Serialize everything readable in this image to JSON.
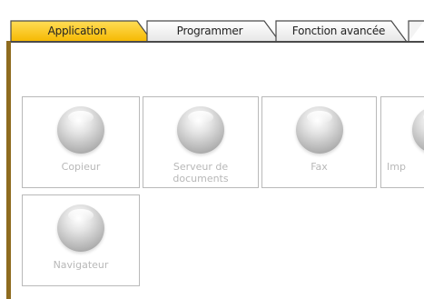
{
  "tabs": [
    {
      "label": "Application",
      "active": true
    },
    {
      "label": "Programmer",
      "active": false
    },
    {
      "label": "Fonction avancée",
      "active": false
    }
  ],
  "apps": [
    {
      "label": "Copieur",
      "icon": "copier-icon"
    },
    {
      "label": "Serveur de\ndocuments",
      "icon": "document-server-icon"
    },
    {
      "label": "Fax",
      "icon": "fax-icon"
    },
    {
      "label": "Imp",
      "icon": "printer-icon"
    },
    {
      "label": "Navigateur",
      "icon": "browser-icon"
    }
  ],
  "colors": {
    "active_tab": "#f7c200",
    "left_accent": "#8e6b1f",
    "disabled_text": "#b8b8b8"
  }
}
